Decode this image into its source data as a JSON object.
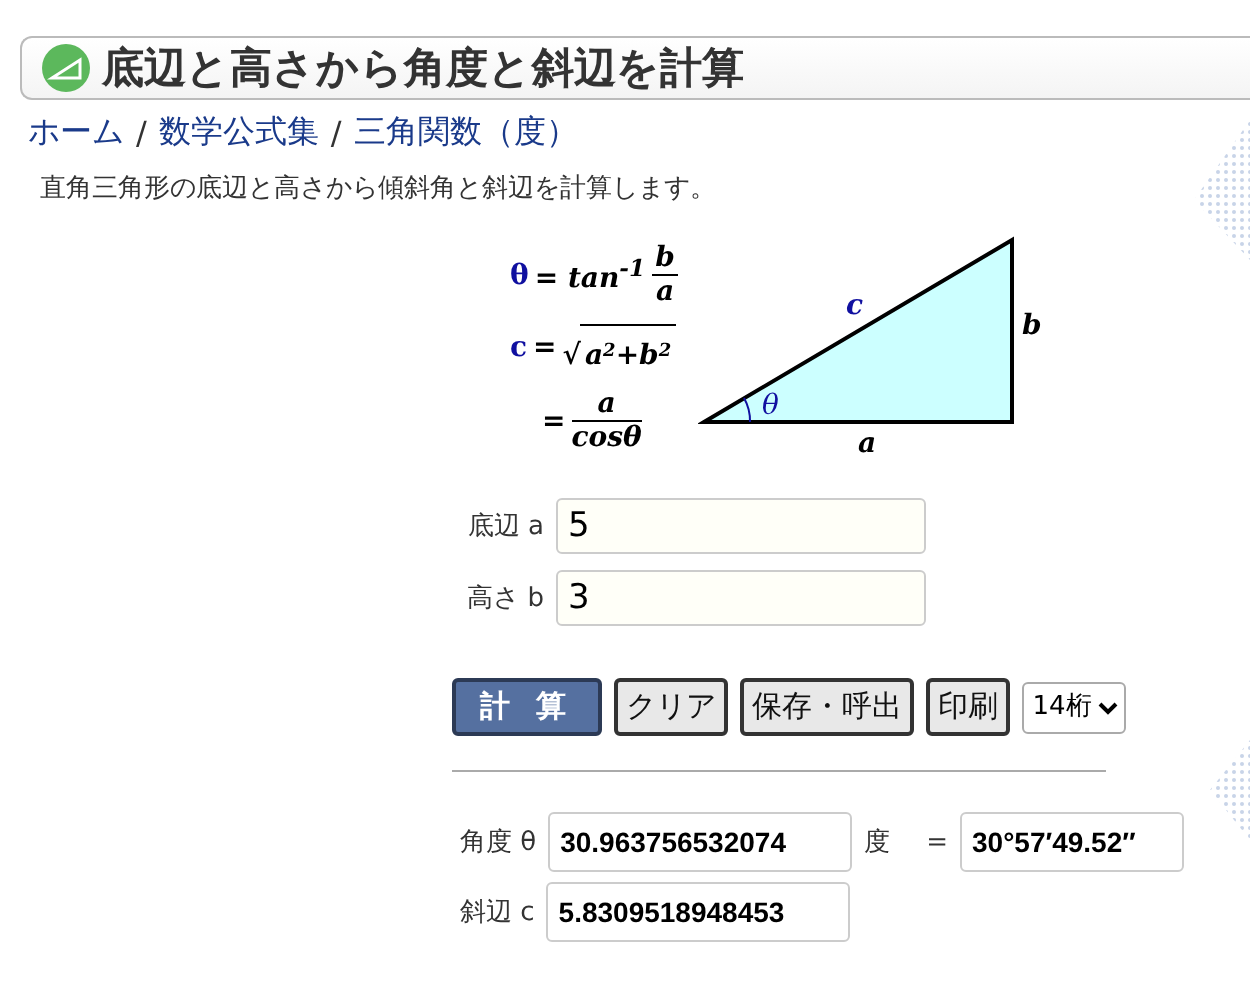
{
  "title": "底辺と高さから角度と斜辺を計算",
  "breadcrumb": [
    {
      "label": "ホーム"
    },
    {
      "label": "数学公式集"
    },
    {
      "label": "三角関数（度）"
    }
  ],
  "breadcrumb_separator": "/",
  "description": "直角三角形の底辺と高さから傾斜角と斜辺を計算します。",
  "formulas": [
    {
      "kind": "fraction",
      "lhs": "θ",
      "prefix": "= tan$^{-1}$",
      "numerator": "b",
      "denominator": "a"
    },
    {
      "kind": "root",
      "lhs": "c",
      "prefix": "=",
      "radical": "√",
      "radicand": "a$^{2}$+b$^{2}$"
    },
    {
      "kind": "fraction",
      "prefix": "=",
      "numerator": "a",
      "denominator": "cosθ"
    }
  ],
  "triangle": {
    "side_a": "a",
    "side_b": "b",
    "side_c": "c",
    "angle": "θ"
  },
  "inputs": [
    {
      "label": "底辺 a",
      "value": "5"
    },
    {
      "label": "高さ b",
      "value": "3"
    }
  ],
  "buttons": [
    {
      "label": "計 算",
      "kind": "primary"
    },
    {
      "label": "クリア",
      "kind": "secondary"
    },
    {
      "label": "保存・呼出",
      "kind": "secondary"
    },
    {
      "label": "印刷",
      "kind": "secondary"
    }
  ],
  "digits": {
    "value": "14桁"
  },
  "results": [
    {
      "label": "角度 θ",
      "value": "30.963756532074",
      "unit": "度",
      "equals": "=",
      "alt_value": "30°57′49.52″"
    },
    {
      "label": "斜辺 c",
      "value": "5.8309518948453"
    }
  ]
}
